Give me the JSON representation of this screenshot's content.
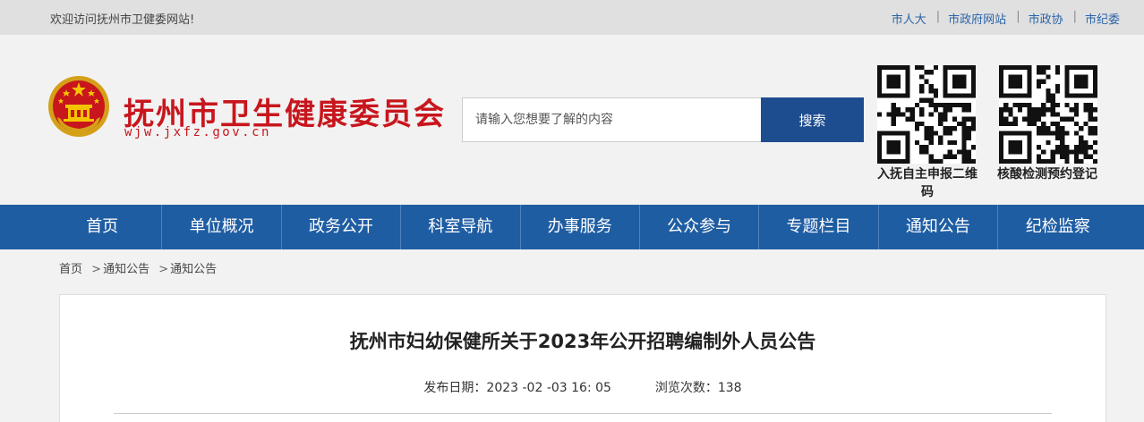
{
  "topbar": {
    "welcome": "欢迎访问抚州市卫健委网站!",
    "links": [
      "市人大",
      "市政府网站",
      "市政协",
      "市纪委"
    ],
    "separator": "|"
  },
  "header": {
    "title": "抚州市卫生健康委员会",
    "domain": "wjw.jxfz.gov.cn",
    "search_placeholder": "请输入您想要了解的内容",
    "search_button": "搜索",
    "qr_codes": [
      {
        "caption": "入抚自主申报二维码"
      },
      {
        "caption": "核酸检测预约登记"
      }
    ]
  },
  "nav": {
    "items": [
      "首页",
      "单位概况",
      "政务公开",
      "科室导航",
      "办事服务",
      "公众参与",
      "专题栏目",
      "通知公告",
      "纪检监察"
    ]
  },
  "breadcrumb": {
    "items": [
      "首页",
      "通知公告",
      "通知公告"
    ],
    "separator": ">"
  },
  "article": {
    "title": "抚州市妇幼保健所关于2023年公开招聘编制外人员公告",
    "date_label": "发布日期：",
    "date": "2023 -02 -03 16: 05",
    "views_label": "浏览次数：",
    "views": "138"
  },
  "colors": {
    "brand_red": "#c8161d",
    "nav_blue": "#1f5da3",
    "search_button_blue": "#1e4d8f",
    "link_blue": "#2a64a8"
  }
}
